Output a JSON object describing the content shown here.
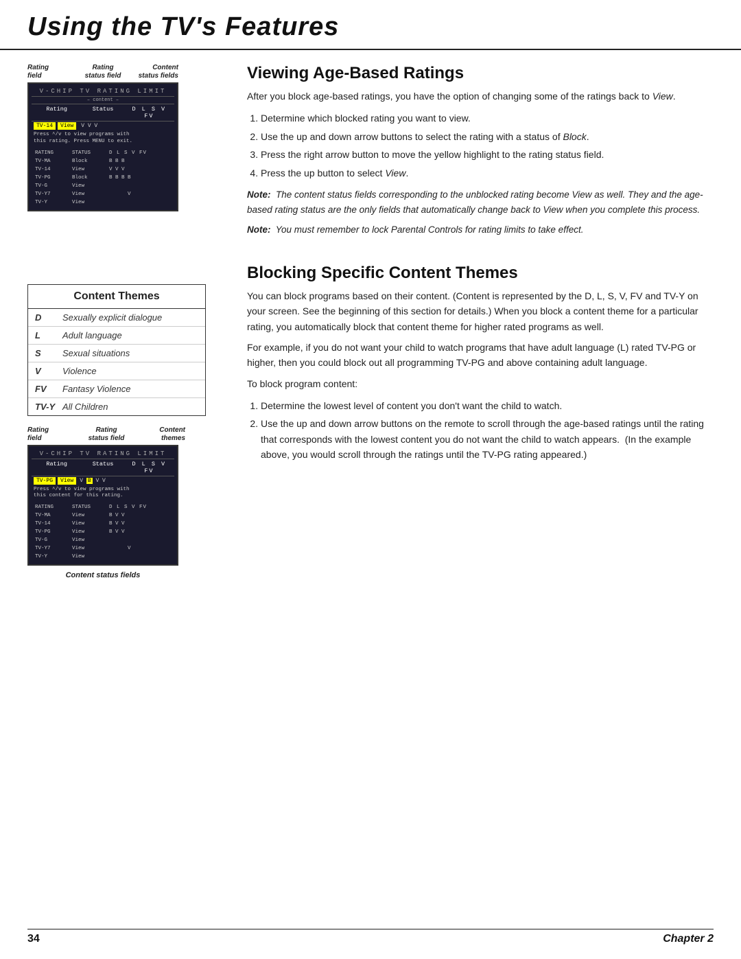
{
  "header": {
    "title": "Using the TV's Features"
  },
  "section1": {
    "title": "Viewing Age-Based Ratings",
    "body1": "After you block age-based ratings, you have the option of changing some of the ratings back to View.",
    "steps": [
      "Determine which blocked rating you want to view.",
      "Use the up and down arrow buttons to select the rating with a status of Block.",
      "Press the right arrow button to move the yellow highlight to the rating status field.",
      "Press the up button to select View."
    ],
    "note1": "Note:  The content status fields corresponding to the unblocked rating become View as well. They and the age-based rating status are the only fields that automatically change back to View when you complete this process.",
    "note2": "Note:  You must remember to lock Parental Controls for rating limits to take effect."
  },
  "tv1": {
    "labels": {
      "rating_field": "Rating field",
      "rating_status": "Rating status field",
      "content_status": "Content status fields"
    },
    "title_bar": "V-CHIP TV RATING LIMIT",
    "sub_bar": "– content –",
    "header": [
      "Rating",
      "Status",
      "D L S V FV"
    ],
    "selected_row_val": "TV-14",
    "selected_status": "View",
    "selected_checks": "V  V  V",
    "info_text": "Press ^/v to view programs with this rating. Press MENU to exit.",
    "rows": [
      {
        "rating": "TV-MA",
        "status": "Block",
        "d": "B",
        "l": "B",
        "s": "B",
        "v": "",
        "fv": ""
      },
      {
        "rating": "TV-14",
        "status": "View",
        "d": "V",
        "l": "V",
        "s": "V",
        "v": "",
        "fv": ""
      },
      {
        "rating": "TV-PG",
        "status": "Block",
        "d": "B",
        "l": "B",
        "s": "B",
        "v": "B",
        "fv": ""
      },
      {
        "rating": "TV-G",
        "status": "View",
        "d": "",
        "l": "",
        "s": "",
        "v": "",
        "fv": ""
      },
      {
        "rating": "TV-Y7",
        "status": "View",
        "d": "",
        "l": "",
        "s": "",
        "v": "V",
        "fv": ""
      },
      {
        "rating": "TV-Y",
        "status": "View",
        "d": "",
        "l": "",
        "s": "",
        "v": "",
        "fv": ""
      }
    ]
  },
  "content_themes": {
    "header": "Content Themes",
    "rows": [
      {
        "key": "D",
        "value": "Sexually explicit dialogue"
      },
      {
        "key": "L",
        "value": "Adult language"
      },
      {
        "key": "S",
        "value": "Sexual situations"
      },
      {
        "key": "V",
        "value": "Violence"
      },
      {
        "key": "FV",
        "value": "Fantasy Violence"
      },
      {
        "key": "TV-Y",
        "value": "All Children"
      }
    ]
  },
  "section2": {
    "title": "Blocking Specific Content Themes",
    "body1": "You can block programs based on their content. (Content is represented by the D, L, S, V, FV and TV-Y on your screen. See the beginning of this section for details.) When you block a content theme for a particular rating, you automatically block that content theme for higher rated programs as well.",
    "body2": "For example, if you do not want your child to watch programs that have adult language (L) rated TV-PG or higher, then you could block out all programming TV-PG and above containing adult language.",
    "body3": "To block program content:",
    "steps": [
      "Determine the lowest level of content you don't want the child to watch.",
      "Use the up and down arrow buttons on the remote to scroll through the age-based ratings until the rating that corresponds with the lowest content you do not want the child to watch appears.  (In the example above, you would scroll through the ratings until the TV-PG rating appeared.)"
    ]
  },
  "tv2": {
    "labels": {
      "rating_field": "Rating field",
      "rating_status": "Rating status field",
      "content_themes": "Content themes"
    },
    "title_bar": "V-CHIP TV RATING LIMIT",
    "header": [
      "Rating",
      "Status",
      "D L S V FV"
    ],
    "selected_row_val": "TV-PG",
    "selected_status": "View",
    "selected_d": "D",
    "selected_rest": "V  V",
    "info_text": "Press ^/v to view programs with this content for this rating.",
    "rows": [
      {
        "rating": "TV-MA",
        "status": "View",
        "d": "B",
        "l": "V",
        "s": "V",
        "v": "",
        "fv": ""
      },
      {
        "rating": "TV-14",
        "status": "View",
        "d": "B",
        "l": "V",
        "s": "V",
        "v": "",
        "fv": ""
      },
      {
        "rating": "TV-PG",
        "status": "View",
        "d": "B",
        "l": "V",
        "s": "V",
        "v": "",
        "fv": ""
      },
      {
        "rating": "TV-G",
        "status": "View",
        "d": "",
        "l": "",
        "s": "",
        "v": "",
        "fv": ""
      },
      {
        "rating": "TV-Y7",
        "status": "View",
        "d": "",
        "l": "",
        "s": "",
        "v": "V",
        "fv": ""
      },
      {
        "rating": "TV-Y",
        "status": "View",
        "d": "",
        "l": "",
        "s": "",
        "v": "",
        "fv": ""
      }
    ],
    "caption": "Content status fields"
  },
  "footer": {
    "page_num": "34",
    "chapter": "Chapter 2"
  }
}
